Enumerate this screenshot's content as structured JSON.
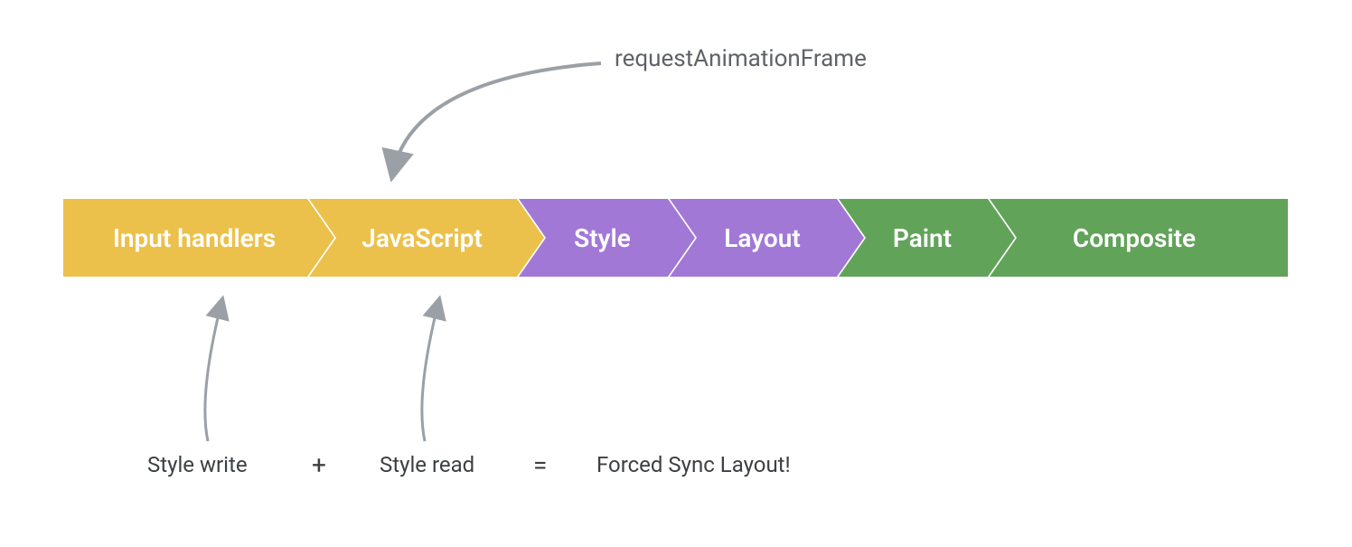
{
  "pipeline": {
    "top_label": "requestAnimationFrame",
    "stages": [
      {
        "label": "Input handlers",
        "color": "#ecc14b"
      },
      {
        "label": "JavaScript",
        "color": "#ecc14b"
      },
      {
        "label": "Style",
        "color": "#a278d7"
      },
      {
        "label": "Layout",
        "color": "#a278d7"
      },
      {
        "label": "Paint",
        "color": "#62a35a"
      },
      {
        "label": "Composite",
        "color": "#62a35a"
      }
    ],
    "bottom": {
      "left_label": "Style write",
      "plus": "+",
      "mid_label": "Style read",
      "equals": "=",
      "result": "Forced Sync Layout!"
    }
  },
  "colors": {
    "arrow": "#9aa0a6",
    "text_muted": "#5f6368",
    "text_dark": "#3c4043"
  }
}
